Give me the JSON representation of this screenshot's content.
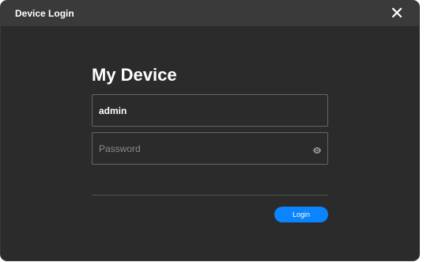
{
  "dialog": {
    "title": "Device Login"
  },
  "form": {
    "heading": "My Device",
    "username_value": "admin",
    "password_placeholder": "Password",
    "login_label": "Login"
  },
  "icons": {
    "close": "close-icon",
    "password_toggle": "eye-icon"
  },
  "colors": {
    "dialog_background": "#2b2b2b",
    "titlebar_background": "#3a3a3a",
    "accent": "#0a84ff"
  }
}
